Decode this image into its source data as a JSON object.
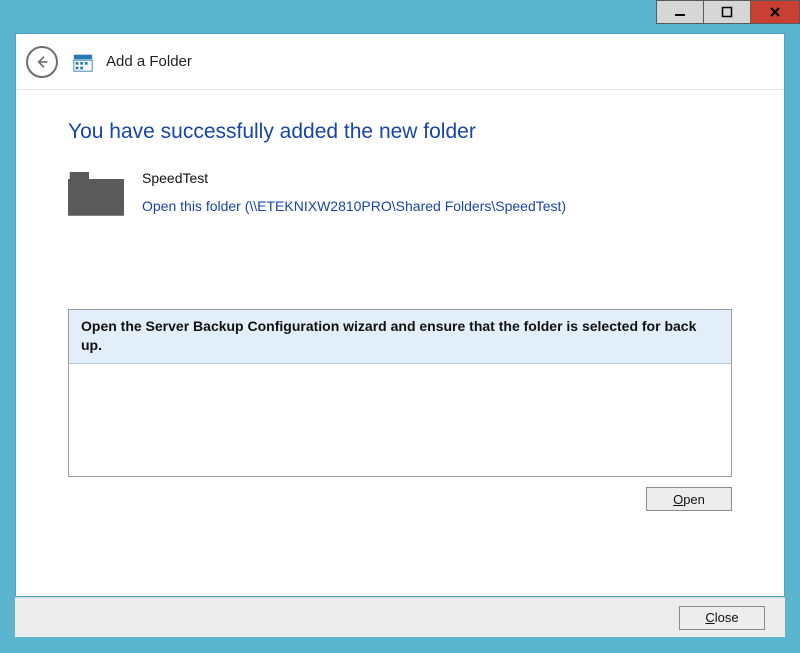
{
  "window": {
    "minimize_glyph": "—",
    "maximize_glyph": "▢",
    "close_glyph": "✕"
  },
  "header": {
    "title": "Add a Folder"
  },
  "main": {
    "heading": "You have successfully added the new folder",
    "folder_name": "SpeedTest",
    "open_link": "Open this folder (\\\\ETEKNIXW2810PRO\\Shared Folders\\SpeedTest)",
    "info_text": "Open the Server Backup Configuration wizard and ensure that the folder is selected for back up."
  },
  "buttons": {
    "open": "Open",
    "close": "Close"
  }
}
